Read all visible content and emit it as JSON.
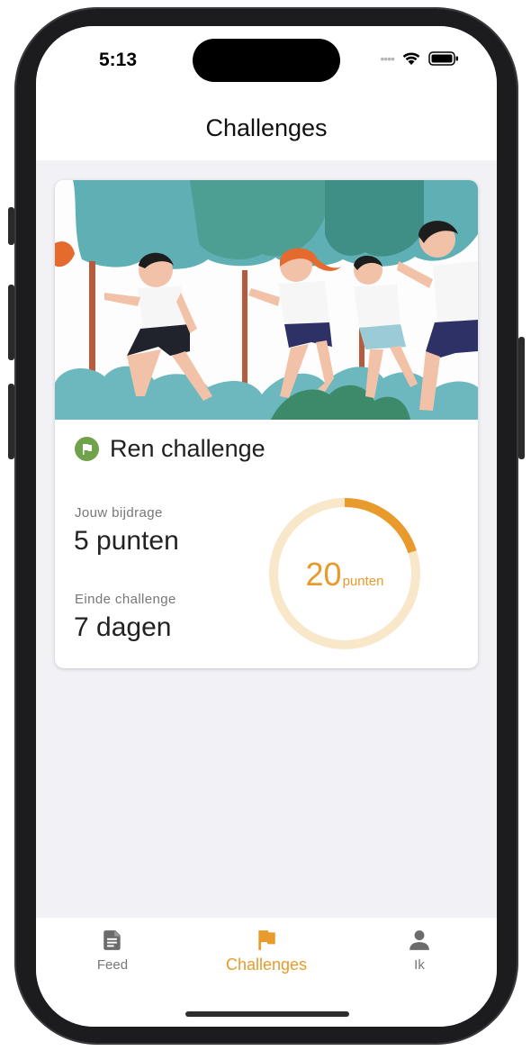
{
  "status_bar": {
    "time": "5:13",
    "signal_icon": "signal-dots-icon",
    "wifi_icon": "wifi-icon",
    "battery_icon": "battery-icon"
  },
  "nav": {
    "title": "Challenges"
  },
  "challenge": {
    "image_icon": "running-kids-illustration",
    "flag_icon": "flag-icon",
    "title": "Ren challenge",
    "contribution_label": "Jouw bijdrage",
    "contribution_value": "5 punten",
    "end_label": "Einde challenge",
    "end_value": "7 dagen",
    "progress": {
      "value": "20",
      "unit": "punten",
      "fraction": 0.2
    }
  },
  "tabs": [
    {
      "label": "Feed",
      "icon": "document-icon",
      "active": false
    },
    {
      "label": "Challenges",
      "icon": "flag-icon",
      "active": true
    },
    {
      "label": "Ik",
      "icon": "person-icon",
      "active": false
    }
  ],
  "colors": {
    "accent": "#e89b2c",
    "ring_track": "#f8e7c9",
    "flag_badge": "#6fa24a",
    "background": "#f2f1f6"
  }
}
